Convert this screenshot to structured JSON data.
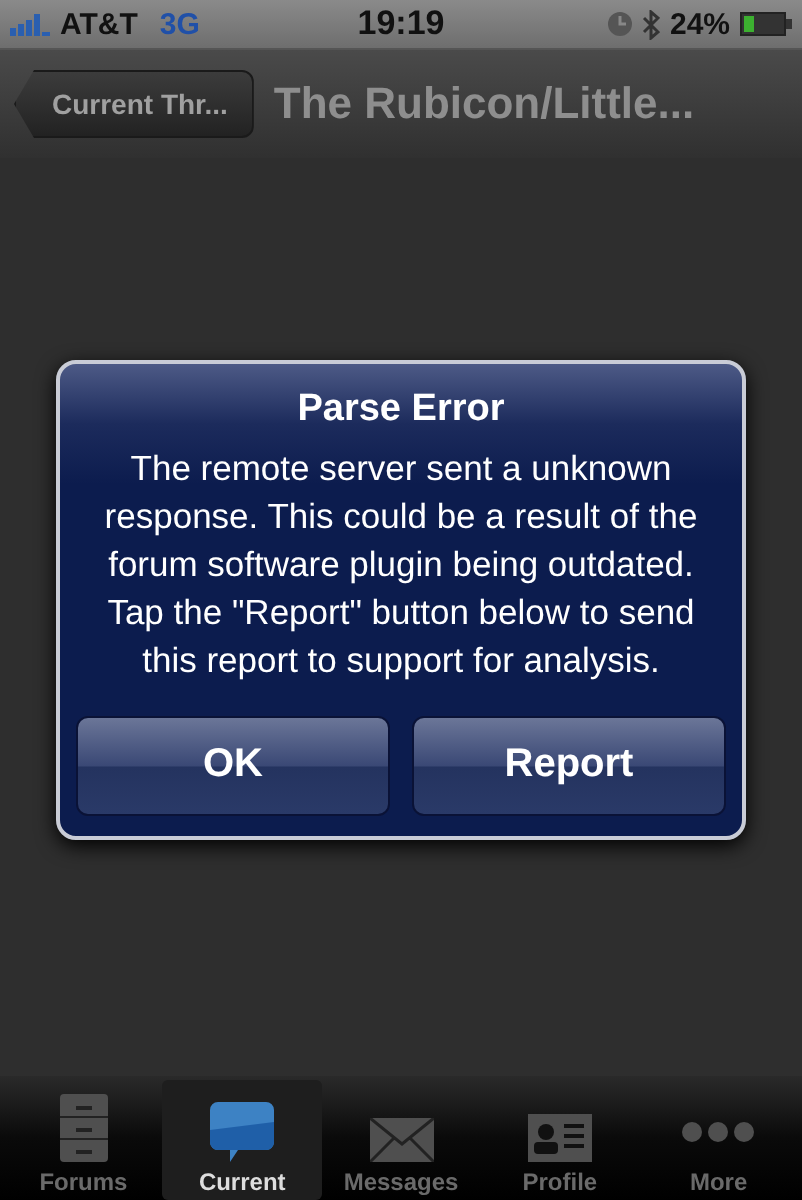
{
  "status_bar": {
    "carrier": "AT&T",
    "network": "3G",
    "time": "19:19",
    "battery": "24%"
  },
  "nav_bar": {
    "back_button": "Current Thr...",
    "title": "The Rubicon/Little..."
  },
  "alert": {
    "title": "Parse Error",
    "message": "The remote server sent a unknown response.  This could be a result of the forum software plugin being outdated.  Tap the \"Report\" button below to send this report to support for analysis.",
    "buttons": [
      "OK",
      "Report"
    ]
  },
  "tab_bar": [
    {
      "label": "Forums",
      "kind": "cabinet",
      "selected": false
    },
    {
      "label": "Current",
      "kind": "bubble",
      "selected": true
    },
    {
      "label": "Messages",
      "kind": "envelope",
      "selected": false
    },
    {
      "label": "Profile",
      "kind": "card",
      "selected": false
    },
    {
      "label": "More",
      "kind": "dots",
      "selected": false
    }
  ]
}
